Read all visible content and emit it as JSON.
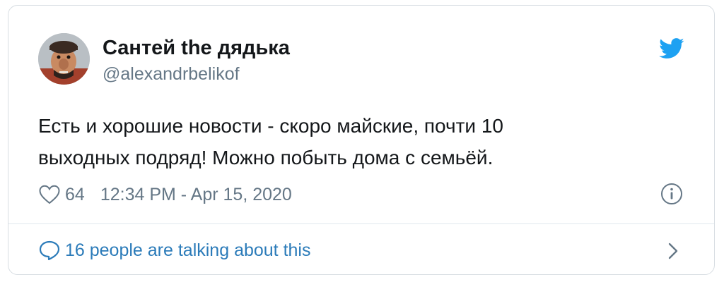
{
  "author": {
    "display_name": "Сантей the дядька",
    "handle": "@alexandrbelikof",
    "avatar_icon": "avatar-cartoon-character"
  },
  "tweet": {
    "text_line_1": "Есть и хорошие новости - скоро майские, почти 10",
    "text_line_2": "выходных подряд! Можно побыть дома с семьёй."
  },
  "meta": {
    "like_count": "64",
    "timestamp": "12:34 PM - Apr 15, 2020"
  },
  "footer": {
    "conversation_label": "16 people are talking about this"
  },
  "icons": {
    "brand": "twitter-bird-icon",
    "like": "heart-icon",
    "info": "info-icon",
    "conversation": "speech-bubble-icon",
    "more": "chevron-right-icon"
  },
  "colors": {
    "brand_blue": "#1da1f2",
    "link_blue": "#2b7bb9",
    "text_primary": "#14171a",
    "text_secondary": "#657786"
  }
}
